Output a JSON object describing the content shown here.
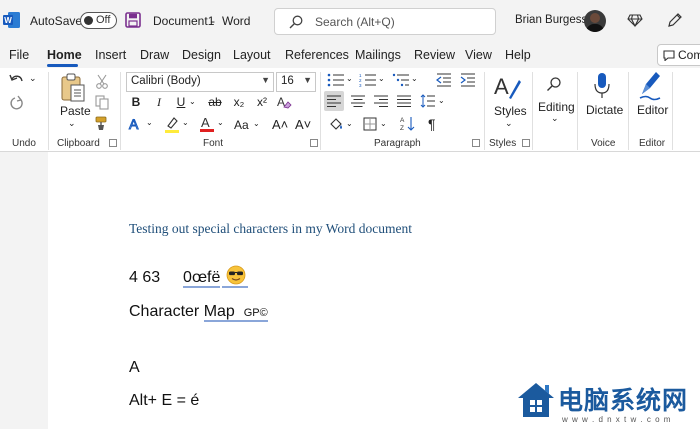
{
  "titlebar": {
    "autosave_label": "AutoSave",
    "autosave_state": "Off",
    "doc_name": "Document1",
    "separator": "-",
    "app_name": "Word",
    "search_placeholder": "Search (Alt+Q)",
    "user_name": "Brian Burgess"
  },
  "menu": {
    "items": [
      "File",
      "Home",
      "Insert",
      "Draw",
      "Design",
      "Layout",
      "References",
      "Mailings",
      "Review",
      "View",
      "Help"
    ],
    "active": "Home",
    "comments_label": "Comments"
  },
  "ribbon": {
    "groups": {
      "undo": "Undo",
      "clipboard": "Clipboard",
      "font": "Font",
      "paragraph": "Paragraph",
      "styles": "Styles",
      "voice": "Voice",
      "editor": "Editor"
    },
    "paste_label": "Paste",
    "font_name": "Calibri (Body)",
    "font_size": "16",
    "styles_label": "Styles",
    "editing_label": "Editing",
    "dictate_label": "Dictate",
    "editor_label": "Editor",
    "format_buttons": [
      "B",
      "I",
      "U",
      "ab",
      "x₂",
      "x²"
    ],
    "case_label": "Aa",
    "grow_label": "A˄",
    "shrink_label": "A˅",
    "pilcrow": "¶",
    "colors": {
      "highlight": "#ffeb3b",
      "font_color": "#e02020",
      "accent": "#185abd"
    }
  },
  "document": {
    "heading": "Testing out special characters in my Word document",
    "line1_num": "4 63",
    "line1_chars": "0œfë",
    "line2_word1": "Character",
    "line2_word2": "Map",
    "line2_small": "GP©",
    "line3": "A",
    "line4": "Alt+ E = é"
  },
  "watermark": {
    "text": "电脑系统网",
    "url": "w w w . d n x t w . c o m"
  }
}
